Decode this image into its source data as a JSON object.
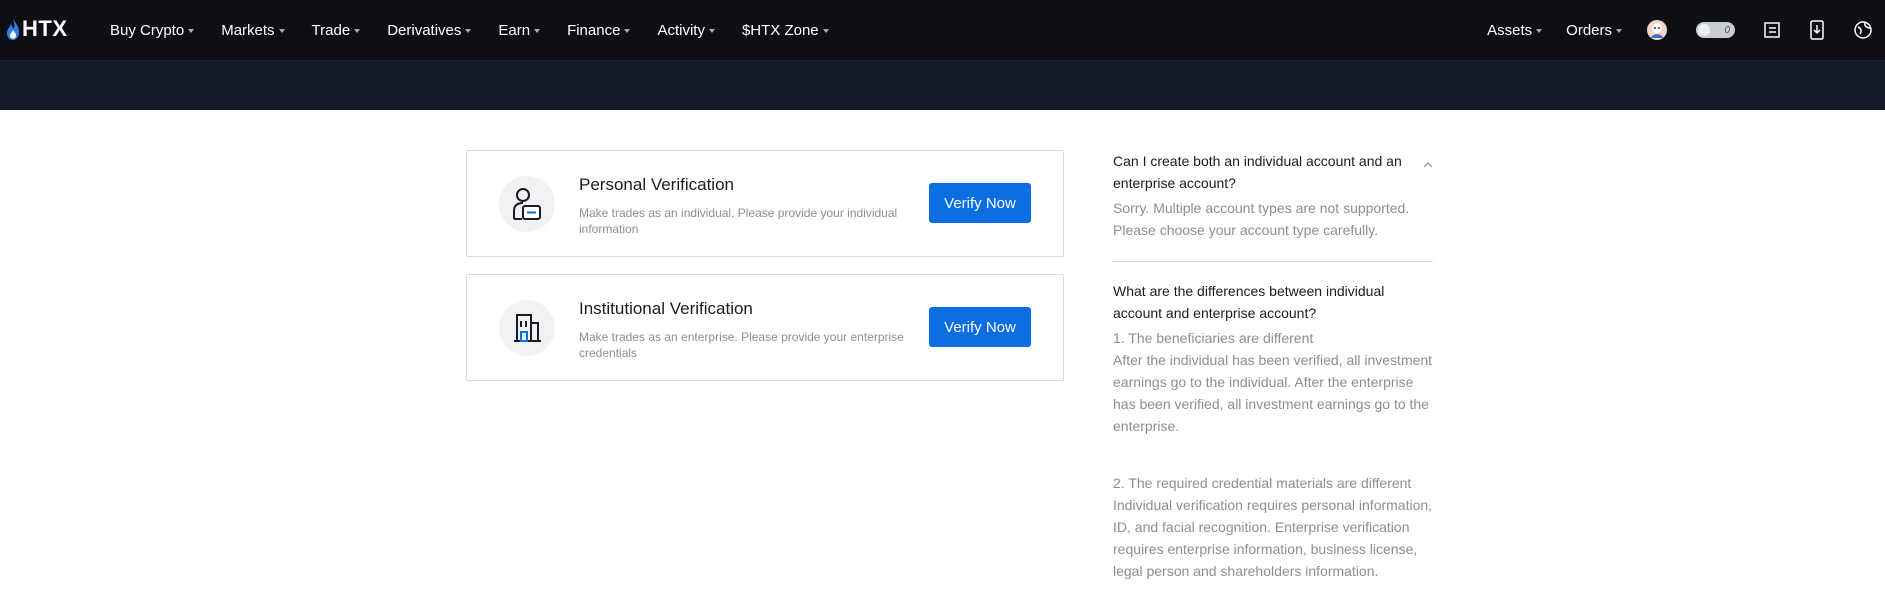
{
  "brand": {
    "name": "HTX"
  },
  "nav": {
    "items": [
      {
        "label": "Buy Crypto"
      },
      {
        "label": "Markets"
      },
      {
        "label": "Trade"
      },
      {
        "label": "Derivatives"
      },
      {
        "label": "Earn"
      },
      {
        "label": "Finance"
      },
      {
        "label": "Activity"
      },
      {
        "label": "$HTX Zone"
      }
    ],
    "right": {
      "assets_label": "Assets",
      "orders_label": "Orders",
      "toggle_value": "0",
      "icons": [
        "avatar-icon",
        "toggle-icon",
        "order-list-icon",
        "download-icon",
        "globe-icon"
      ]
    }
  },
  "cards": [
    {
      "title": "Personal Verification",
      "desc": "Make trades as an individual. Please provide your individual information",
      "button": "Verify Now",
      "icon": "person-id-icon"
    },
    {
      "title": "Institutional Verification",
      "desc": "Make trades as an enterprise. Please provide your enterprise credentials",
      "button": "Verify Now",
      "icon": "building-icon"
    }
  ],
  "faq": [
    {
      "question": "Can I create both an individual account and an enterprise account?",
      "answer": "Sorry. Multiple account types are not supported. Please choose your account type carefully."
    },
    {
      "question": "What are the differences between individual account and enterprise account?",
      "answer_point1_title": "1. The beneficiaries are different",
      "answer_point1_body": "After the individual has been verified, all investment earnings go to the individual. After the enterprise has been verified, all investment earnings go to the enterprise.",
      "answer_point2_title": "2. The required credential materials are different",
      "answer_point2_body": "Individual verification requires personal information, ID, and facial recognition. Enterprise verification requires enterprise information, business license, legal person and shareholders information."
    }
  ],
  "colors": {
    "nav_bg": "#0e0f14",
    "banner_bg": "#151a2b",
    "primary_button": "#0b6ee0",
    "brand_flame": "#2f80ed"
  }
}
